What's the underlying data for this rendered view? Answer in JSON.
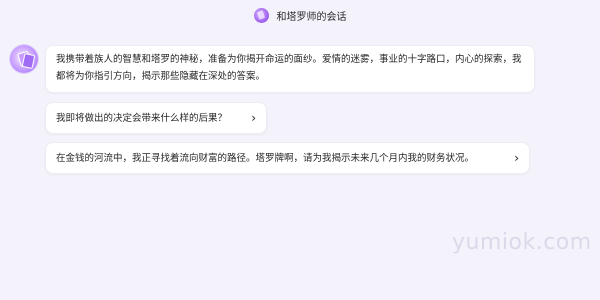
{
  "header": {
    "title": "和塔罗师的会话",
    "avatar_icon": "tarot-avatar-icon"
  },
  "chat": {
    "bot_avatar_icon": "tarot-reader-avatar-icon",
    "intro_message": "我携带着族人的智慧和塔罗的神秘，准备为你揭开命运的面纱。爱情的迷雾，事业的十字路口，内心的探索，我都将为你指引方向，揭示那些隐藏在深处的答案。",
    "suggestions": [
      {
        "text": "我即将做出的决定会带来什么样的后果？",
        "icon": "chevron-right-icon"
      },
      {
        "text": "在金钱的河流中，我正寻找着流向财富的路径。塔罗牌啊，请为我揭示未来几个月内我的财务状况。",
        "icon": "chevron-right-icon"
      }
    ]
  },
  "watermark": "yumiok.com",
  "colors": {
    "background": "#f4f3fb",
    "bubble": "#ffffff",
    "accent": "#a76cf0"
  }
}
